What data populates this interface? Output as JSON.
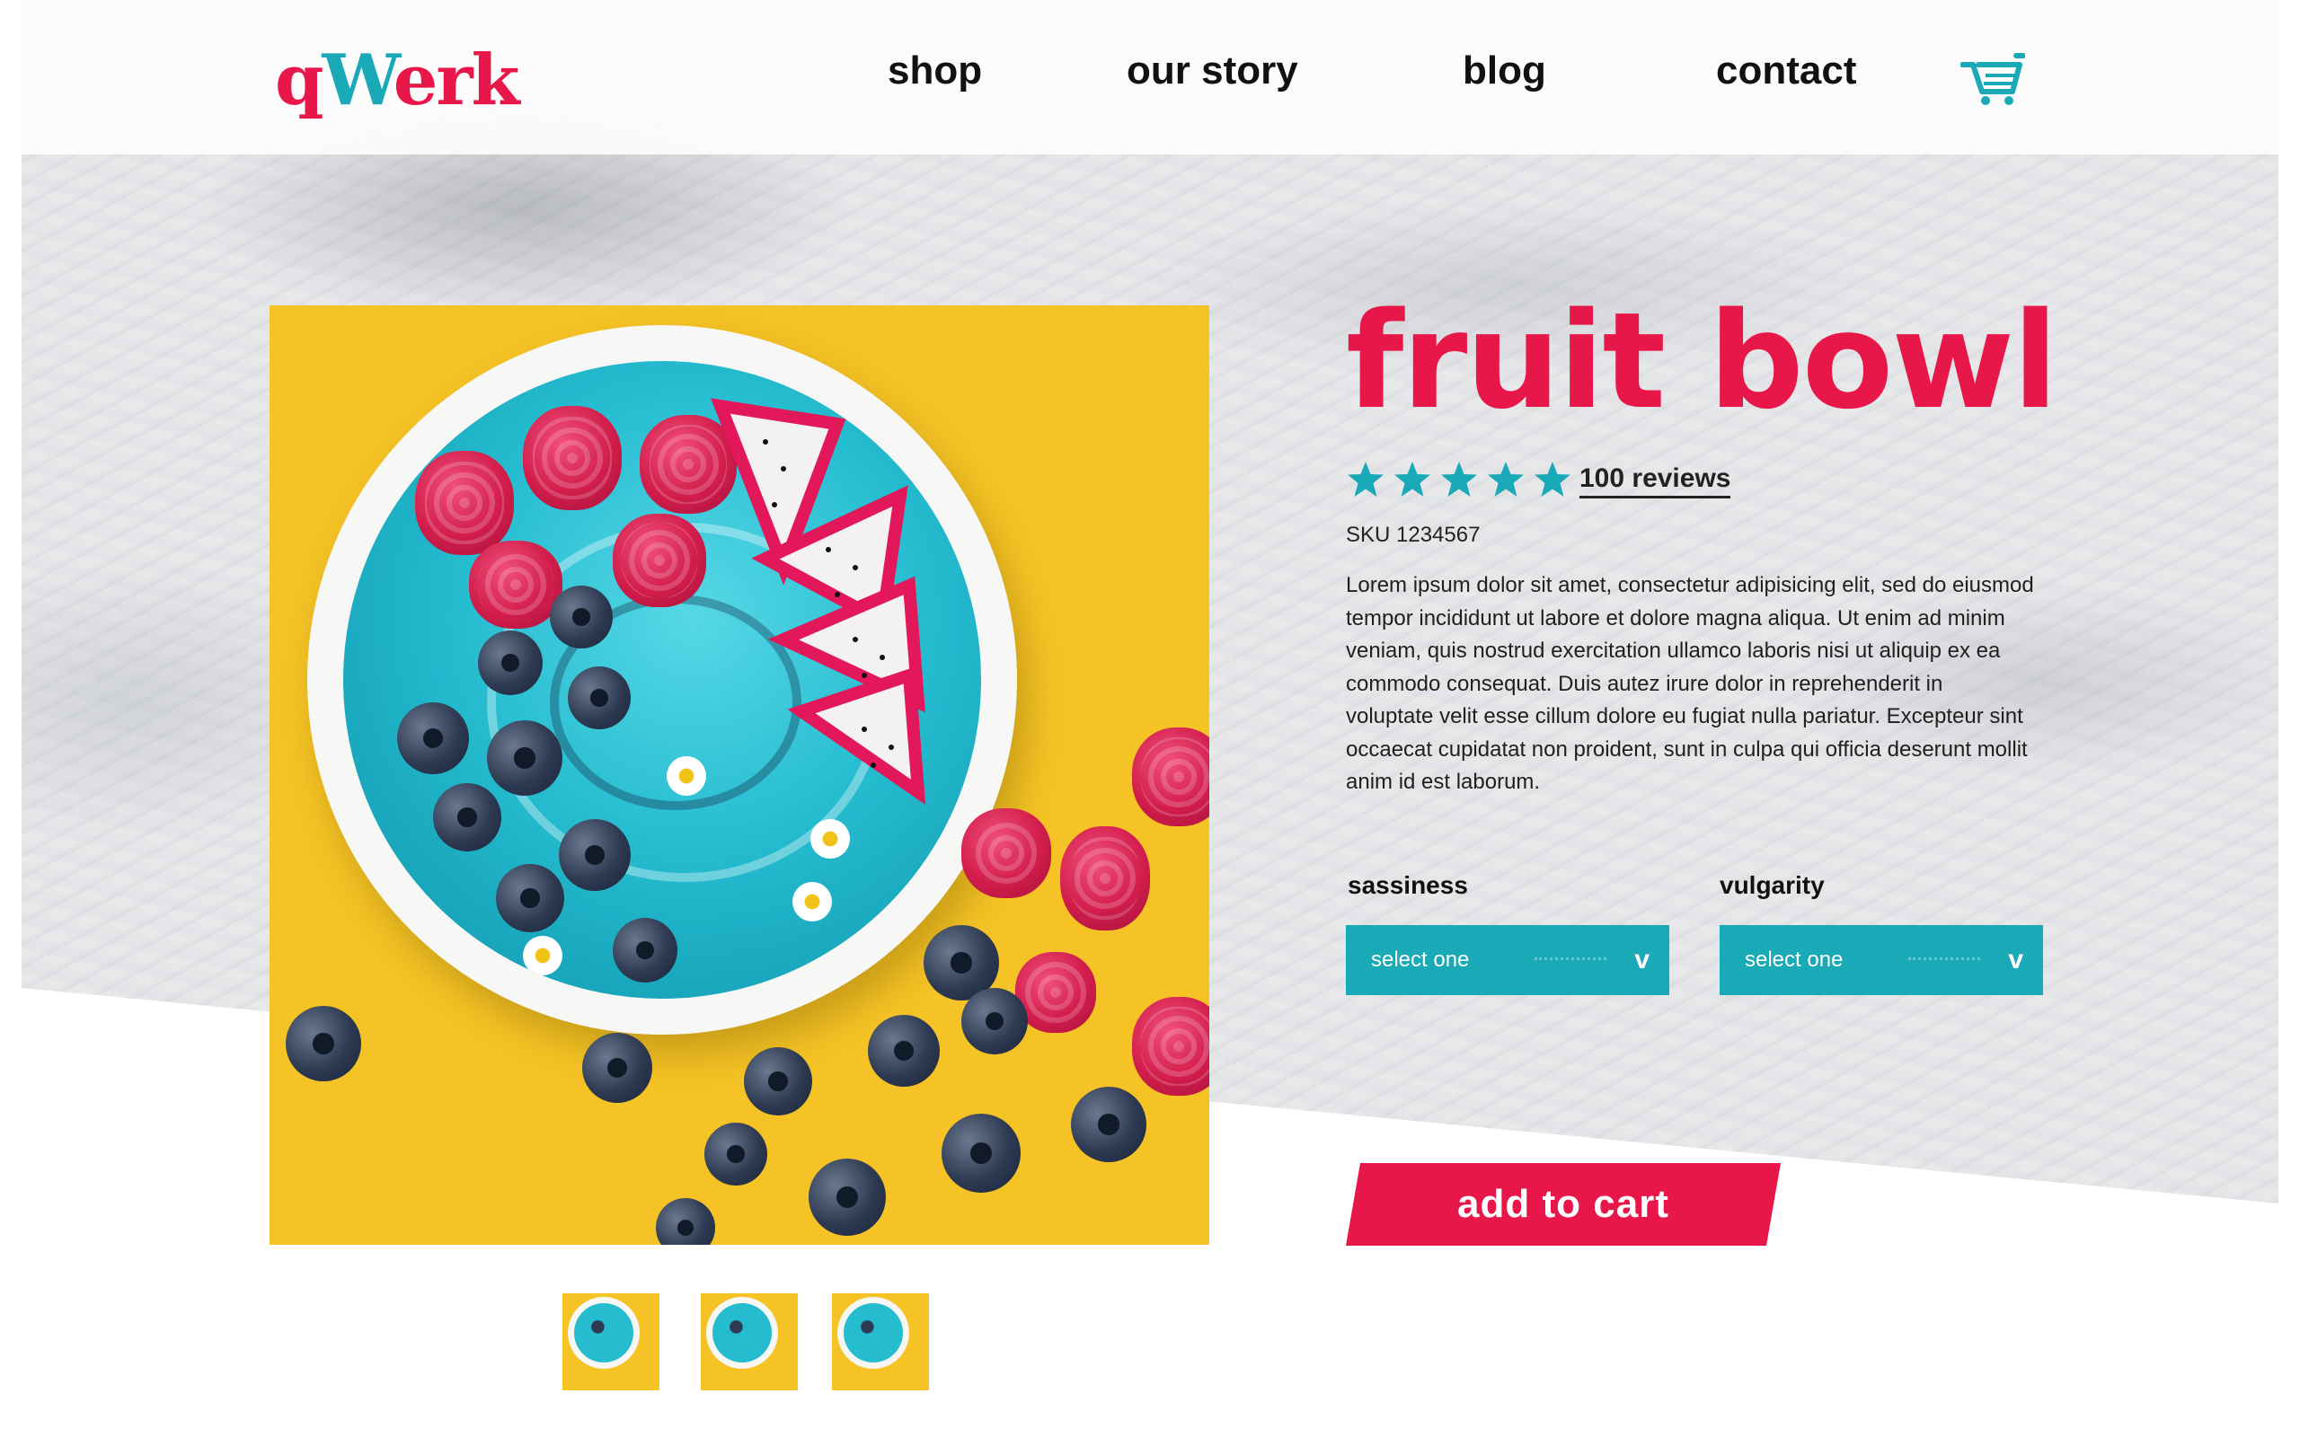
{
  "brand": {
    "logo_q": "q",
    "logo_w": "W",
    "logo_rest": "erk",
    "colors": {
      "accent": "#e8174a",
      "teal": "#1aa9b6",
      "hero_bg": "#f5c325"
    }
  },
  "nav": {
    "items": [
      "shop",
      "our story",
      "blog",
      "contact"
    ],
    "cart_icon": "shopping-cart-icon"
  },
  "product": {
    "title": "fruit bowl",
    "rating_stars": 5,
    "reviews_label": "100 reviews",
    "sku": "SKU 1234567",
    "description": "Lorem ipsum dolor sit amet, consectetur adipisicing elit, sed do eiusmod tempor incididunt ut labore et dolore magna aliqua. Ut enim ad minim veniam, quis nostrud exercitation ullamco laboris nisi ut aliquip ex ea commodo consequat. Duis autez irure dolor in reprehenderit in voluptate velit esse cillum dolore eu fugiat nulla pariatur. Excepteur sint occaecat cupidatat non proident, sunt in culpa qui officia deserunt mollit anim id est laborum.",
    "options": [
      {
        "label": "sassiness",
        "value": "select one"
      },
      {
        "label": "vulgarity",
        "value": "select one"
      }
    ],
    "add_to_cart": "add to cart",
    "thumbnails_count": 3
  }
}
